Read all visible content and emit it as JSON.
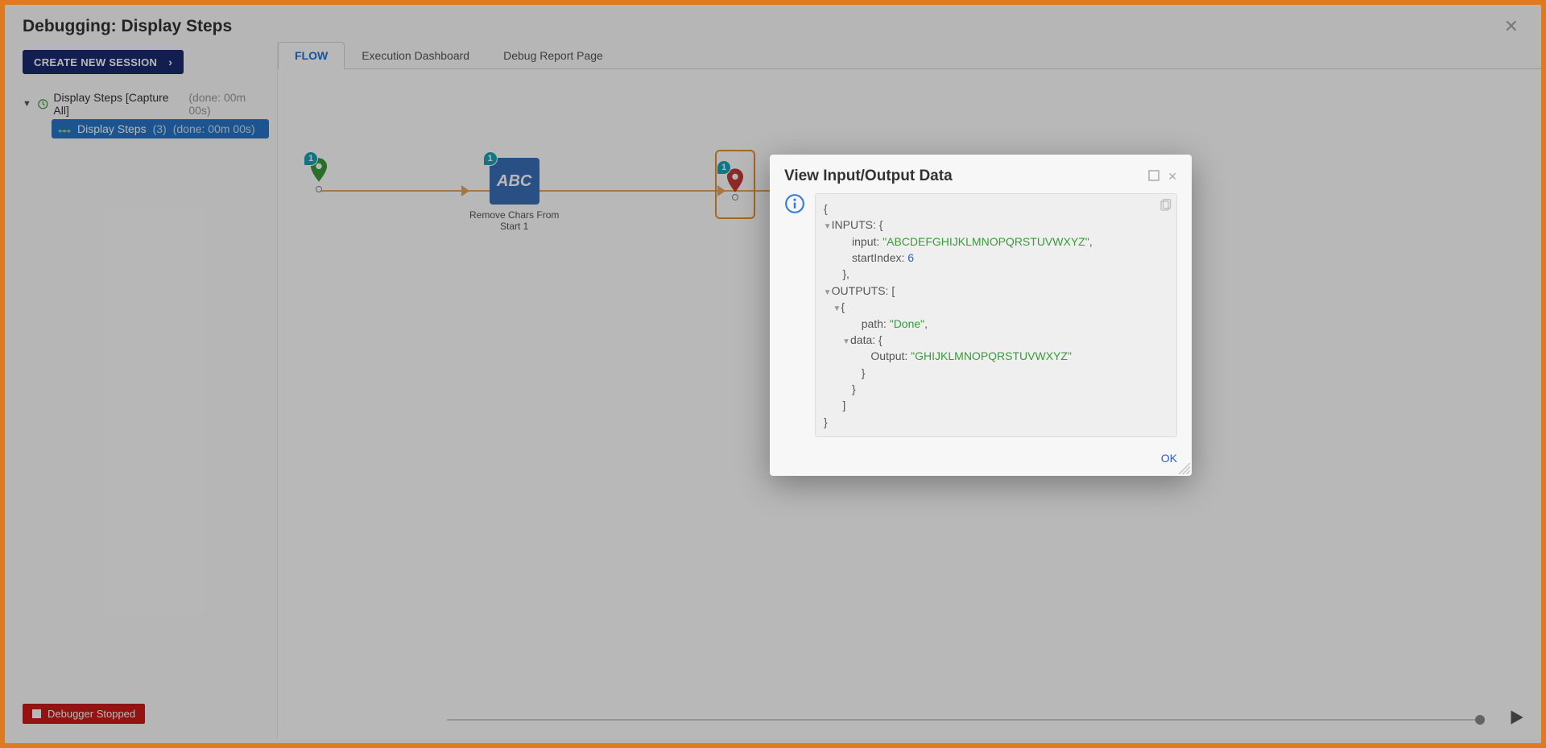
{
  "header": {
    "title": "Debugging: Display Steps",
    "close_aria": "Close"
  },
  "sidebar": {
    "create_session_label": "CREATE NEW SESSION",
    "root": {
      "label": "Display Steps [Capture All]",
      "suffix": "(done: 00m 00s)"
    },
    "child": {
      "label": "Display Steps",
      "count": "(3)",
      "suffix": "(done: 00m 00s)"
    },
    "status": "Debugger Stopped"
  },
  "tabs": {
    "flow": "FLOW",
    "execution": "Execution Dashboard",
    "debug_report": "Debug Report Page"
  },
  "canvas": {
    "start_badge": "1",
    "block_badge": "1",
    "end_badge": "1",
    "block_text": "ABC",
    "block_label_line1": "Remove Chars From",
    "block_label_line2": "Start 1"
  },
  "modal": {
    "title": "View Input/Output Data",
    "ok_label": "OK",
    "json": {
      "inputs_key": "INPUTS:",
      "input_key": "input:",
      "input_val": "\"ABCDEFGHIJKLMNOPQRSTUVWXYZ\"",
      "startIndex_key": "startIndex:",
      "startIndex_val": "6",
      "outputs_key": "OUTPUTS:",
      "path_key": "path:",
      "path_val": "\"Done\"",
      "data_key": "data:",
      "output_key": "Output:",
      "output_val": "\"GHIJKLMNOPQRSTUVWXYZ\"",
      "brace_open": "{",
      "brace_close": "}",
      "bracket_open": "[",
      "bracket_close": "]",
      "comma": ","
    }
  }
}
